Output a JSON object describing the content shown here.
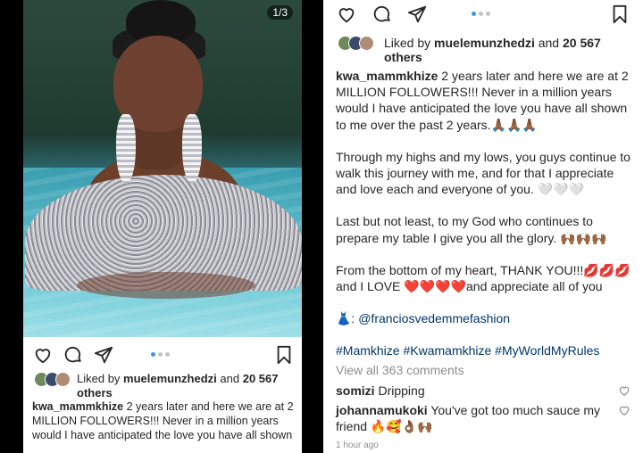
{
  "left": {
    "counter": "1/3",
    "likes": {
      "prefix": "Liked by ",
      "user": "muelemunzhedzi",
      "mid": " and ",
      "count": "20 567",
      "suffix": "others"
    },
    "caption": {
      "user": "kwa_mammkhize",
      "text": " 2 years later and here we are at 2 MILLION FOLLOWERS!!! Never in a million years would I have anticipated the love you have all shown"
    }
  },
  "right": {
    "likes": {
      "prefix": "Liked by ",
      "user": "muelemunzhedzi",
      "mid": " and ",
      "count": "20 567",
      "suffix": "others"
    },
    "caption": {
      "user": "kwa_mammkhize",
      "p1": " 2 years later and here we are at 2 MILLION FOLLOWERS!!! Never in a million years would I have anticipated the love you have all shown to me over the past 2 years.🙏🏾🙏🏾🙏🏾",
      "p2": "Through my highs and my lows, you guys continue to walk this journey with me, and for that I appreciate and love each and everyone of you. 🤍🤍🤍",
      "p3": "Last but not least, to my God who continues to prepare my table I give you all the glory. 🙌🏾🙌🏾🙌🏾",
      "p4": "From the bottom of my heart, THANK YOU!!!💋💋💋 and I LOVE ❤️❤️❤️❤️and appreciate all of you",
      "p5_prefix": "👗: ",
      "p5_mention": "@franciosvedemmefashion",
      "tags": "#Mamkhize #Kwamamkhize #MyWorldMyRules"
    },
    "view_all": "View all 363 comments",
    "comments": [
      {
        "user": "somizi",
        "text": " Dripping"
      },
      {
        "user": "johannamukoki",
        "text": " You've got too much sauce my friend 🔥🥰👌🏾🙌🏾"
      }
    ],
    "time": "1 hour ago"
  },
  "colors": {
    "link": "#00376b",
    "muted": "#8e8e8e",
    "active_dot": "#3897f0"
  },
  "icons": [
    "heart-icon",
    "comment-icon",
    "share-icon",
    "bookmark-icon"
  ]
}
